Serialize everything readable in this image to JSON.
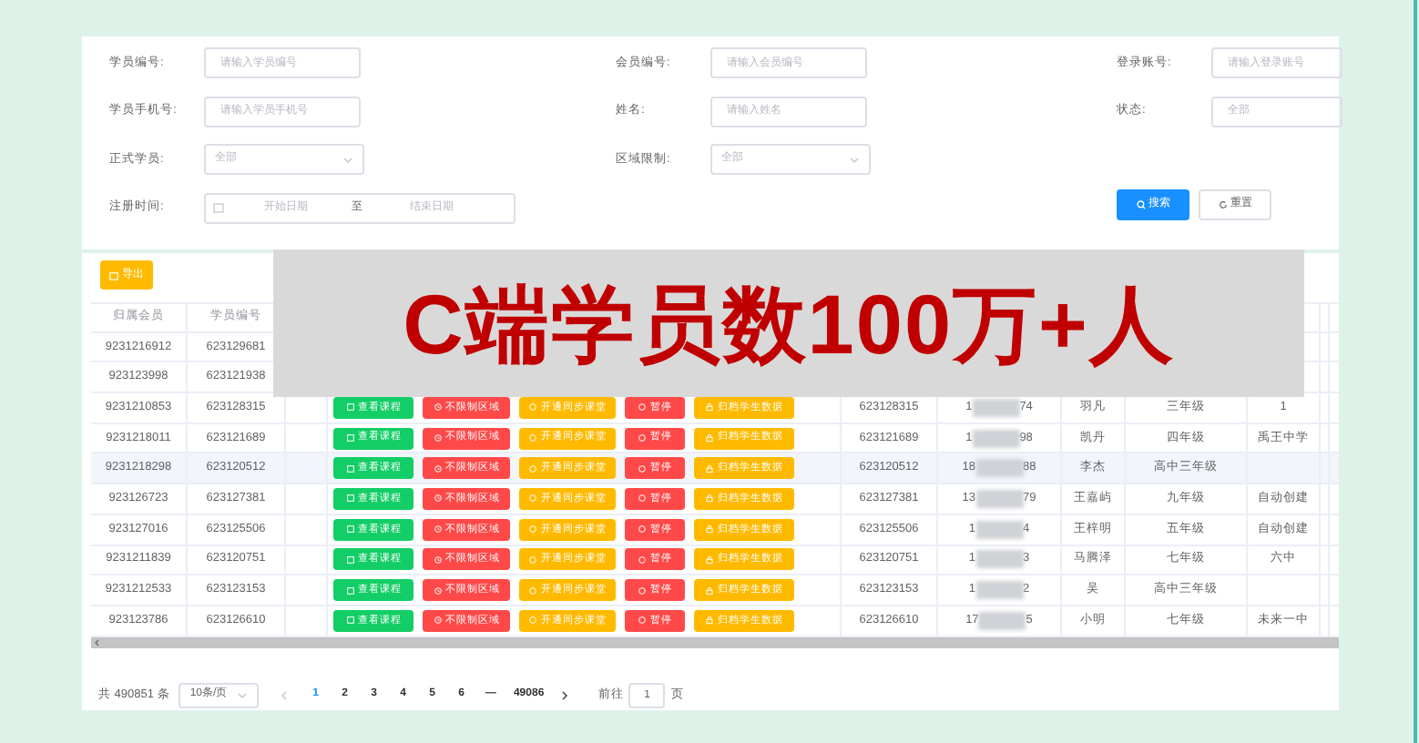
{
  "filters": {
    "rows": [
      [
        {
          "label": "学员编号:",
          "kind": "input",
          "placeholder": "请输入学员编号"
        },
        {
          "label": "会员编号:",
          "kind": "input",
          "placeholder": "请输入会员编号"
        },
        {
          "label": "登录账号:",
          "kind": "input",
          "placeholder": "请输入登录账号"
        }
      ],
      [
        {
          "label": "学员手机号:",
          "kind": "input",
          "placeholder": "请输入学员手机号"
        },
        {
          "label": "姓名:",
          "kind": "input",
          "placeholder": "请输入姓名"
        },
        {
          "label": "状态:",
          "kind": "plain",
          "placeholder": "全部"
        }
      ],
      [
        {
          "label": "正式学员:",
          "kind": "select",
          "placeholder": "全部"
        },
        {
          "label": "区域限制:",
          "kind": "select",
          "placeholder": "全部"
        }
      ],
      [
        {
          "label": "注册时间:",
          "kind": "daterange",
          "start": "开始日期",
          "separator": "至",
          "end": "结束日期"
        }
      ]
    ]
  },
  "search_button": "搜索",
  "reset_button": "重置",
  "export_button": "导出",
  "banner": {
    "text": "C端学员数100万+人"
  },
  "table": {
    "columns": [
      "归属会员",
      "学员编号"
    ],
    "rows": [
      {
        "member": "9231216912",
        "student_id": "623129681"
      },
      {
        "member": "923123998",
        "student_id": "623121938"
      },
      {
        "member": "9231210853",
        "student_id": "623128315",
        "actions": [
          "查看课程",
          "不限制区域",
          "开通同步课堂",
          "暂停",
          "归档学生数据"
        ],
        "student_id_2": "623128315",
        "phone_prefix": "1",
        "phone_suffix": "74",
        "name": "羽凡",
        "grade": "三年级",
        "school": "1",
        "selected": false
      },
      {
        "member": "9231218011",
        "student_id": "623121689",
        "actions": [
          "查看课程",
          "不限制区域",
          "开通同步课堂",
          "暂停",
          "归档学生数据"
        ],
        "student_id_2": "623121689",
        "phone_prefix": "1",
        "phone_suffix": "98",
        "name": "凯丹",
        "grade": "四年级",
        "school": "禹王中学",
        "selected": false
      },
      {
        "member": "9231218298",
        "student_id": "623120512",
        "actions": [
          "查看课程",
          "不限制区域",
          "开通同步课堂",
          "暂停",
          "归档学生数据"
        ],
        "student_id_2": "623120512",
        "phone_prefix": "18",
        "phone_suffix": "88",
        "name": "李杰",
        "grade": "高中三年级",
        "selected": true
      },
      {
        "member": "923126723",
        "student_id": "623127381",
        "actions": [
          "查看课程",
          "不限制区域",
          "开通同步课堂",
          "暂停",
          "归档学生数据"
        ],
        "student_id_2": "623127381",
        "phone_prefix": "13",
        "phone_suffix": "79",
        "name": "王嘉屿",
        "grade": "九年级",
        "school": "自动创建",
        "selected": false
      },
      {
        "member": "923127016",
        "student_id": "623125506",
        "actions": [
          "查看课程",
          "不限制区域",
          "开通同步课堂",
          "暂停",
          "归档学生数据"
        ],
        "student_id_2": "623125506",
        "phone_prefix": "1",
        "phone_suffix": "4",
        "name": "王梓明",
        "grade": "五年级",
        "school": "自动创建",
        "selected": false
      },
      {
        "member": "9231211839",
        "student_id": "623120751",
        "actions": [
          "查看课程",
          "不限制区域",
          "开通同步课堂",
          "暂停",
          "归档学生数据"
        ],
        "student_id_2": "623120751",
        "phone_prefix": "1",
        "phone_suffix": "3",
        "name": "马腾泽",
        "grade": "七年级",
        "school": "六中",
        "selected": false
      },
      {
        "member": "9231212533",
        "student_id": "623123153",
        "actions": [
          "查看课程",
          "不限制区域",
          "开通同步课堂",
          "暂停",
          "归档学生数据"
        ],
        "student_id_2": "623123153",
        "phone_prefix": "1",
        "phone_suffix": "2",
        "name": "吴",
        "grade": "高中三年级",
        "selected": false
      },
      {
        "member": "923123786",
        "student_id": "623126610",
        "actions": [
          "查看课程",
          "不限制区域",
          "开通同步课堂",
          "暂停",
          "归档学生数据"
        ],
        "student_id_2": "623126610",
        "phone_prefix": "17",
        "phone_suffix": "5",
        "name": "小明",
        "grade": "七年级",
        "school": "未来一中",
        "selected": false
      }
    ]
  },
  "pagination": {
    "total": "共 490851 条",
    "page_size": "10条/页",
    "pages": [
      {
        "label": "1",
        "selected": true
      },
      {
        "label": "2",
        "selected": false
      },
      {
        "label": "3",
        "selected": false
      },
      {
        "label": "4",
        "selected": false
      },
      {
        "label": "5",
        "selected": false
      },
      {
        "label": "6",
        "selected": false
      },
      {
        "label": "—",
        "selected": false
      },
      {
        "label": "49086",
        "selected": false
      }
    ],
    "goto_label": "前往",
    "goto_value": "1",
    "page_unit": "页"
  }
}
